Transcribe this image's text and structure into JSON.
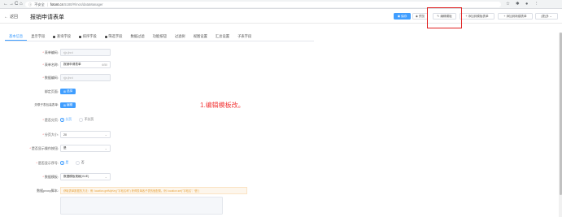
{
  "browser": {
    "back": "←",
    "forward": "→",
    "reload": "C",
    "home": "⌂",
    "security": "不安全",
    "host": "fotont.cn",
    "path": ":5180/#/mcs/dataManager",
    "icons": [
      "star-icon",
      "extension-icon",
      "profile-icon",
      "menu-icon"
    ]
  },
  "header": {
    "back_label": "返回",
    "title": "报销申请表单",
    "buttons": {
      "save": "保存",
      "preview": "预览",
      "edit_template": "编辑模板",
      "add_template_table": "添加到模板表单",
      "add_new_table": "添加到新建表单",
      "more": "(更)多"
    }
  },
  "tabs": [
    {
      "label": "基本信息",
      "dot": false
    },
    {
      "label": "显示字段",
      "dot": false
    },
    {
      "label": "查询字段",
      "dot": true
    },
    {
      "label": "排序字段",
      "dot": true
    },
    {
      "label": "筛选字段",
      "dot": true
    },
    {
      "label": "数据过滤",
      "dot": false
    },
    {
      "label": "功能按钮",
      "dot": false
    },
    {
      "label": "过滤树",
      "dot": false
    },
    {
      "label": "视图设置",
      "dot": false
    },
    {
      "label": "汇总设置",
      "dot": false
    },
    {
      "label": "子表字段",
      "dot": false
    }
  ],
  "form": {
    "table_code": {
      "label": "表单编码:",
      "value": "rjjx.jhrd"
    },
    "table_name": {
      "label": "表单名称:",
      "value": "报销申请表单",
      "count": "6/50"
    },
    "data_code": {
      "label": "数据编码:",
      "value": "rjjx.jhrd"
    },
    "bind_page": {
      "label": "绑定页面:",
      "button": "选择"
    },
    "child_tables": {
      "label": "关联子表包装表单:",
      "button": "编辑"
    },
    "paging": {
      "label": "是否分页:",
      "options": [
        "分页",
        "不分页"
      ],
      "selected": 0
    },
    "page_size": {
      "label": "分页大小:",
      "value": "20"
    },
    "show_actions": {
      "label": "是否显示操作按钮:",
      "value": "是"
    },
    "show_serial": {
      "label": "是否显示序号:",
      "options": [
        "是",
        "否"
      ],
      "selected": 0
    },
    "data_template": {
      "label": "数据模板:",
      "value": "数据模板规格(VUE)"
    },
    "js_proxy": {
      "label": "数据proxy脚本:",
      "hint": "获取表单数据的方法：例: location.getMyKey(\"字段名称\") 获得表单各子表的值配置。例: location.set(\"字段名\", \"值\")"
    }
  },
  "annotation": "1.编辑模板改。",
  "colors": {
    "accent": "#409eff",
    "highlight": "#e02020",
    "annotation": "#f23a3a"
  }
}
